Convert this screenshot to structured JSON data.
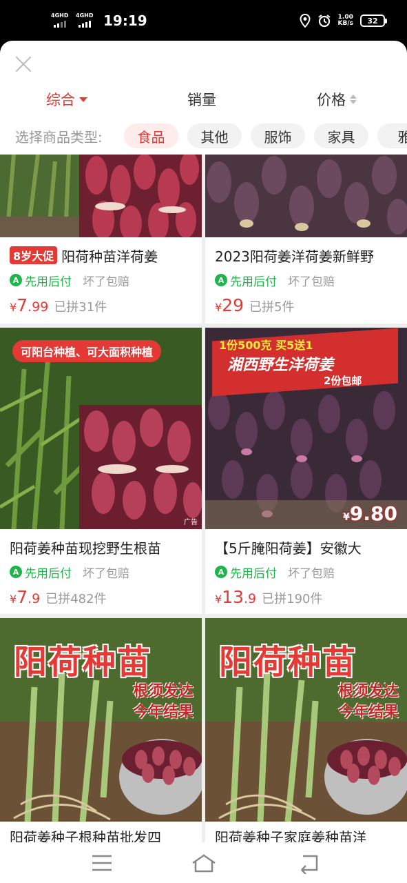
{
  "status_bar": {
    "network_1": "4GHD",
    "network_2": "4GHD",
    "time": "19:19",
    "speed_value": "1.00",
    "speed_unit": "KB/s",
    "battery": "32"
  },
  "sort_tabs": [
    {
      "label": "综合",
      "active": true
    },
    {
      "label": "销量",
      "active": false
    },
    {
      "label": "价格",
      "active": false
    }
  ],
  "type_filter": {
    "label": "选择商品类型:",
    "chips": [
      "食品",
      "其他",
      "服饰",
      "家具",
      "雅"
    ]
  },
  "products": [
    {
      "promo": "8岁大促",
      "title": "阳荷种苗洋荷姜",
      "pay_later": "先用后付",
      "guarantee": "坏了包赔",
      "price_int": "7",
      "price_dec": ".99",
      "sold": "已拼31件"
    },
    {
      "title": "2023阳荷姜洋荷姜新鲜野",
      "pay_later": "先用后付",
      "guarantee": "坏了包赔",
      "price_int": "29",
      "price_dec": "",
      "sold": "已拼5件"
    },
    {
      "banner": "可阳台种植、可大面积种植",
      "ad_tag": "广告",
      "title": "阳荷姜种苗现挖野生根苗",
      "pay_later": "先用后付",
      "guarantee": "坏了包赔",
      "price_int": "7",
      "price_dec": ".9",
      "sold": "已拼482件"
    },
    {
      "banner_top": "1份500克 买5送1",
      "banner_main": "湘西野生洋荷姜",
      "banner_sub": "2份包邮",
      "badge_yen": "¥",
      "badge_price": "9.80",
      "title": "【5斤腌阳荷姜】安徽大",
      "pay_later": "先用后付",
      "guarantee": "坏了包赔",
      "price_int": "13",
      "price_dec": ".9",
      "sold": "已拼190件"
    },
    {
      "overlay_title": "阳荷种苗",
      "overlay_sub_1": "根须发达",
      "overlay_sub_2": "今年结果",
      "title": "阳荷姜种子根种苗批发四"
    },
    {
      "overlay_title": "阳荷种苗",
      "overlay_sub_1": "根须发达",
      "overlay_sub_2": "今年结果",
      "title": "阳荷姜种子家庭姜种苗洋"
    }
  ],
  "currency": "¥",
  "pay_icon_letter": "A",
  "colors": {
    "accent": "#e53935",
    "green": "#1fb54a",
    "muted": "#999999"
  }
}
